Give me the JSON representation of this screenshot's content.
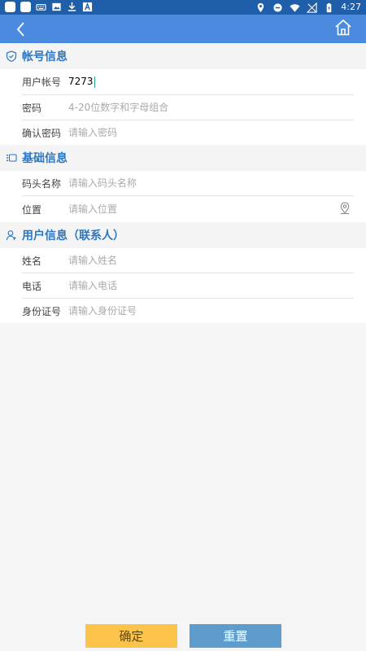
{
  "status_bar": {
    "time": "4:27"
  },
  "colors": {
    "status_bar": "#1f5fa9",
    "app_bar": "#4a8bdf",
    "section_title": "#2e77c0",
    "confirm_button": "#fcc44a",
    "reset_button": "#5e9ccd"
  },
  "sections": {
    "account": {
      "title": "帐号信息",
      "icon": "shield-check-icon",
      "username": {
        "label": "用户帐号",
        "value": "7273"
      },
      "password": {
        "label": "密码",
        "placeholder": "4-20位数字和字母组合"
      },
      "confirm_password": {
        "label": "确认密码",
        "placeholder": "请输入密码"
      }
    },
    "basic": {
      "title": "基础信息",
      "icon": "list-icon",
      "dock_name": {
        "label": "码头名称",
        "placeholder": "请输入码头名称"
      },
      "location": {
        "label": "位置",
        "placeholder": "请输入位置",
        "icon": "location-pin-icon"
      }
    },
    "user": {
      "title": "用户信息（联系人）",
      "icon": "person-icon",
      "name": {
        "label": "姓名",
        "placeholder": "请输入姓名"
      },
      "phone": {
        "label": "电话",
        "placeholder": "请输入电话"
      },
      "id_number": {
        "label": "身份证号",
        "placeholder": "请输入身份证号"
      }
    }
  },
  "buttons": {
    "confirm": "确定",
    "reset": "重置"
  }
}
